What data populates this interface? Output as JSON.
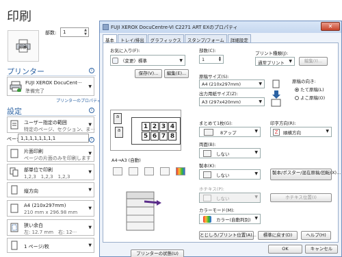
{
  "print_pane": {
    "title": "印刷",
    "print_button": "印刷",
    "copies_label": "部数:",
    "copies_value": "1",
    "printer_section": "プリンター",
    "printer_name": "FUJI XEROX DocuCent···",
    "printer_status": "準備完了",
    "printer_properties_link": "プリンターのプロパティ",
    "settings_section": "設定",
    "range": {
      "title": "ユーザー指定の範囲",
      "subtitle": "特定のページ、セクション、ま···"
    },
    "pages_label": "ページ:",
    "pages_value": "1,1,1,1,1,1,1,1",
    "sides": {
      "title": "片面印刷",
      "subtitle": "ページの片面のみを印刷します"
    },
    "collate": {
      "title": "部単位で印刷",
      "subtitle": "1,2,3　1,2,3　1,2,3"
    },
    "orientation": {
      "title": "縦方向"
    },
    "paper": {
      "title": "A4 (210x297mm)",
      "subtitle": "210 mm x 296.98 mm"
    },
    "margins": {
      "title": "狭い余白",
      "subtitle": "左: 12.7 mm　右: 12···"
    },
    "pages_per_sheet": {
      "title": "1 ページ/枚"
    }
  },
  "dialog": {
    "title": "FUJI XEROX DocuCentre-VI C2271 ART EXのプロパティ",
    "tabs": [
      "基本",
      "トレイ/排出",
      "グラフィックス",
      "スタンプ/フォーム",
      "詳細設定"
    ],
    "favorites_label": "お気に入り(F):",
    "favorites_value": "〈変更〉標準",
    "save_button": "保存(V)...",
    "edit_button": "編集(E)...",
    "preview_caption": "A4→A3 (自動)",
    "preview_numbers": [
      "1",
      "2",
      "3",
      "4",
      "5",
      "6",
      "7",
      "8"
    ],
    "printer_status_button": "プリンターの状態(U)",
    "copies_label": "部数(C):",
    "copies_value": "1",
    "job_type_label": "プリント種類(J):",
    "job_type_value": "通常プリント",
    "job_type_edit": "編集(I)...",
    "paper_size_label": "原稿サイズ(S):",
    "paper_size_value": "A4 (210x297mm)",
    "output_size_label": "出力用紙サイズ(Z):",
    "output_size_value": "A3 (297x420mm)",
    "orientation_label": "原稿の向き:",
    "orientation_portrait": "たて原稿(L)",
    "orientation_landscape": "よこ原稿(O)",
    "nup_label": "まとめて1枚(G):",
    "nup_value": "8アップ",
    "print_order_label": "印字方向(R):",
    "print_order_value": "順横方向",
    "duplex_label": "両面(B):",
    "duplex_value": "しない",
    "booklet_label": "製本(K):",
    "booklet_value": "しない",
    "booklet_button": "製本/ポスター/混在原稿/回転(X)...",
    "staple_label": "ホチキス(P):",
    "staple_value": "しない",
    "staple_button": "ホチキス位置(I)",
    "color_label": "カラーモード(M):",
    "color_value": "カラー(自動判別)",
    "margin_button": "とじしろ/プリント位置(A)...",
    "default_button": "標準に戻す(D)",
    "help_button": "ヘルプ(H)",
    "ok_button": "OK",
    "cancel_button": "キャンセル"
  },
  "colors": {
    "accent": "#2b62a3",
    "titlebar": "#c5d7ef",
    "close": "#c7442b"
  }
}
